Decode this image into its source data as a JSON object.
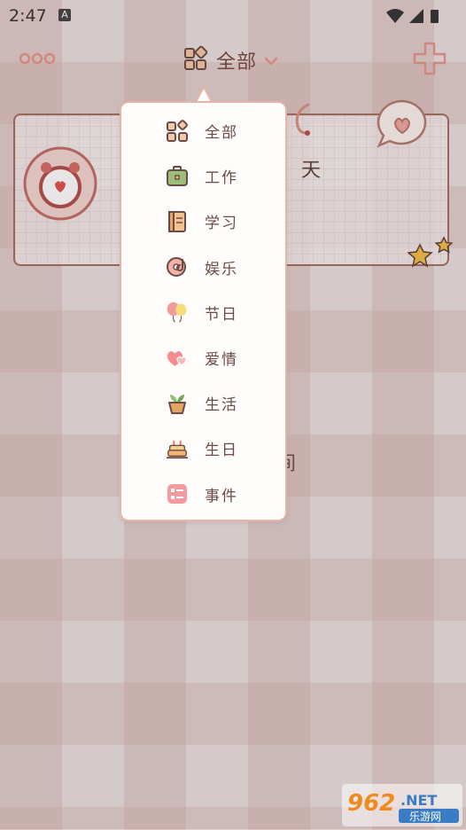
{
  "status_bar": {
    "time": "2:47",
    "notification_badge": "A"
  },
  "header": {
    "filter_label": "全部"
  },
  "card": {
    "partial_text": "天"
  },
  "background_partial_text": "间",
  "category_menu": {
    "items": [
      {
        "label": "全部",
        "icon": "grid-icon"
      },
      {
        "label": "工作",
        "icon": "briefcase-icon"
      },
      {
        "label": "学习",
        "icon": "notebook-icon"
      },
      {
        "label": "娱乐",
        "icon": "music-disc-icon"
      },
      {
        "label": "节日",
        "icon": "balloons-icon"
      },
      {
        "label": "爱情",
        "icon": "hearts-icon"
      },
      {
        "label": "生活",
        "icon": "plant-pot-icon"
      },
      {
        "label": "生日",
        "icon": "birthday-cake-icon"
      },
      {
        "label": "事件",
        "icon": "event-card-icon"
      }
    ]
  },
  "watermark": {
    "number": "962",
    "suffix": ".NET",
    "cn_text": "乐游网"
  },
  "colors": {
    "accent": "#e8958a",
    "menu_border": "#e9b4a8",
    "card_border": "#a56f60",
    "text": "#6b4b45"
  }
}
